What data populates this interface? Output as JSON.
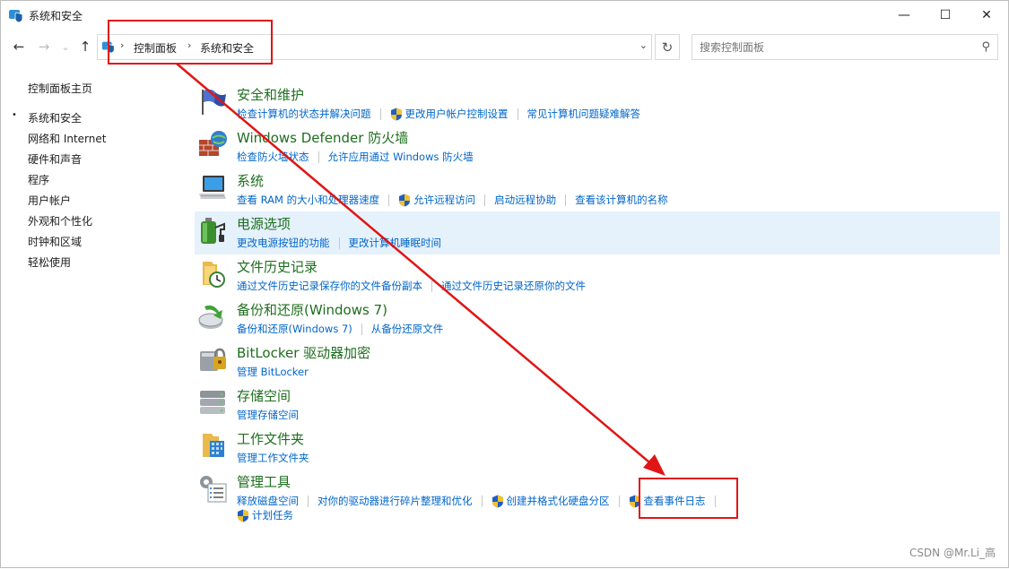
{
  "window": {
    "title": "系统和安全",
    "minimize": "—",
    "maximize": "☐",
    "close": "✕"
  },
  "nav": {
    "back": "←",
    "forward": "→",
    "recent": "⌄",
    "up": "↑",
    "breadcrumbs": [
      "控制面板",
      "系统和安全"
    ],
    "crumb_separator": "›",
    "dropdown": "⌄",
    "refresh": "↻",
    "search_placeholder": "搜索控制面板",
    "search_glyph": "⚲"
  },
  "sidebar": {
    "items": [
      {
        "label": "控制面板主页",
        "active": false
      },
      {
        "label": "系统和安全",
        "active": true
      },
      {
        "label": "网络和 Internet",
        "active": false
      },
      {
        "label": "硬件和声音",
        "active": false
      },
      {
        "label": "程序",
        "active": false
      },
      {
        "label": "用户帐户",
        "active": false
      },
      {
        "label": "外观和个性化",
        "active": false
      },
      {
        "label": "时钟和区域",
        "active": false
      },
      {
        "label": "轻松使用",
        "active": false
      }
    ],
    "active_bullet": "•"
  },
  "categories": [
    {
      "title": "安全和维护",
      "icon": "flag-icon",
      "links": [
        {
          "label": "检查计算机的状态并解决问题",
          "shield": false
        },
        {
          "label": "更改用户帐户控制设置",
          "shield": true
        },
        {
          "label": "常见计算机问题疑难解答",
          "shield": false
        }
      ]
    },
    {
      "title": "Windows Defender 防火墙",
      "icon": "firewall-icon",
      "links": [
        {
          "label": "检查防火墙状态",
          "shield": false
        },
        {
          "label": "允许应用通过 Windows 防火墙",
          "shield": false
        }
      ]
    },
    {
      "title": "系统",
      "icon": "computer-icon",
      "links": [
        {
          "label": "查看 RAM 的大小和处理器速度",
          "shield": false
        },
        {
          "label": "允许远程访问",
          "shield": true
        },
        {
          "label": "启动远程协助",
          "shield": false
        },
        {
          "label": "查看该计算机的名称",
          "shield": false
        }
      ]
    },
    {
      "title": "电源选项",
      "icon": "battery-icon",
      "hover": true,
      "links": [
        {
          "label": "更改电源按钮的功能",
          "shield": false
        },
        {
          "label": "更改计算机睡眠时间",
          "shield": false
        }
      ]
    },
    {
      "title": "文件历史记录",
      "icon": "folder-clock-icon",
      "links": [
        {
          "label": "通过文件历史记录保存你的文件备份副本",
          "shield": false
        },
        {
          "label": "通过文件历史记录还原你的文件",
          "shield": false
        }
      ]
    },
    {
      "title": "备份和还原(Windows 7)",
      "icon": "backup-icon",
      "links": [
        {
          "label": "备份和还原(Windows 7)",
          "shield": false
        },
        {
          "label": "从备份还原文件",
          "shield": false
        }
      ]
    },
    {
      "title": "BitLocker 驱动器加密",
      "icon": "lock-drive-icon",
      "links": [
        {
          "label": "管理 BitLocker",
          "shield": false
        }
      ]
    },
    {
      "title": "存储空间",
      "icon": "storage-icon",
      "links": [
        {
          "label": "管理存储空间",
          "shield": false
        }
      ]
    },
    {
      "title": "工作文件夹",
      "icon": "work-folder-icon",
      "links": [
        {
          "label": "管理工作文件夹",
          "shield": false
        }
      ]
    },
    {
      "title": "管理工具",
      "icon": "admin-tools-icon",
      "links": [
        {
          "label": "释放磁盘空间",
          "shield": false
        },
        {
          "label": "对你的驱动器进行碎片整理和优化",
          "shield": false
        },
        {
          "label": "创建并格式化硬盘分区",
          "shield": true
        },
        {
          "label": "查看事件日志",
          "shield": true
        }
      ],
      "links2": [
        {
          "label": "计划任务",
          "shield": true
        }
      ]
    }
  ],
  "colors": {
    "link": "#0066cc",
    "category_title": "#1e6e1e",
    "hover_bg": "#e5f1fb",
    "annotation_red": "#e01515"
  },
  "watermark": "CSDN @Mr.Li_高"
}
